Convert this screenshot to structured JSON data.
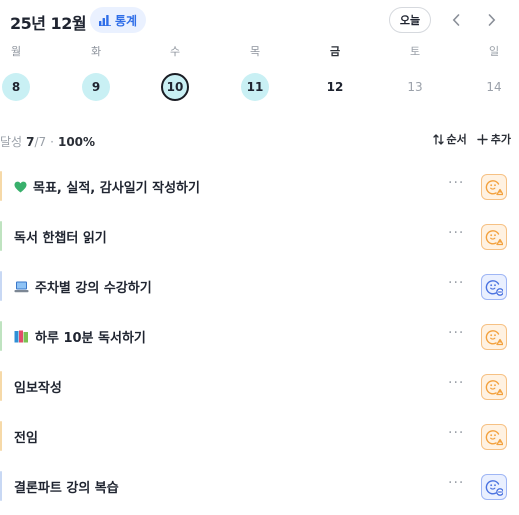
{
  "header": {
    "month_title": "25년 12월",
    "stats_label": "통계",
    "today_label": "오늘",
    "prev_icon": "chevron-left-icon",
    "next_icon": "chevron-right-icon"
  },
  "week": [
    {
      "dow": "월",
      "date": "8",
      "state": "done"
    },
    {
      "dow": "화",
      "date": "9",
      "state": "done"
    },
    {
      "dow": "수",
      "date": "10",
      "state": "selected"
    },
    {
      "dow": "목",
      "date": "11",
      "state": "done"
    },
    {
      "dow": "금",
      "date": "12",
      "state": "today"
    },
    {
      "dow": "토",
      "date": "13",
      "state": "future"
    },
    {
      "dow": "일",
      "date": "14",
      "state": "future"
    }
  ],
  "summary": {
    "label": "달성",
    "done": "7",
    "total": "/7",
    "separator": "·",
    "percent": "100%"
  },
  "actions": {
    "sort_label": "순서",
    "add_label": "추가"
  },
  "tasks": [
    {
      "title": "목표, 실적, 감사일기 작성하기",
      "icon": "green-heart-icon",
      "bar_color": "#f6d9a8",
      "mood": "orange"
    },
    {
      "title": "독서 한챕터 읽기",
      "icon": "",
      "bar_color": "#bfe3c0",
      "mood": "orange"
    },
    {
      "title": "주차별 강의 수강하기",
      "icon": "laptop-icon",
      "bar_color": "#c8d8f4",
      "mood": "blue"
    },
    {
      "title": "하루 10분 독서하기",
      "icon": "books-icon",
      "bar_color": "#bfe3c0",
      "mood": "orange"
    },
    {
      "title": "임보작성",
      "icon": "",
      "bar_color": "#f6d9a8",
      "mood": "orange"
    },
    {
      "title": "전임",
      "icon": "",
      "bar_color": "#f6d9a8",
      "mood": "orange"
    },
    {
      "title": "결론파트 강의 복습",
      "icon": "",
      "bar_color": "#c8d8f4",
      "mood": "blue"
    }
  ],
  "colors": {
    "accent_blue": "#2f6ee8",
    "done_circle": "#c9f0f4",
    "mood_orange": "#f3a13d",
    "mood_blue": "#4a72e0"
  }
}
